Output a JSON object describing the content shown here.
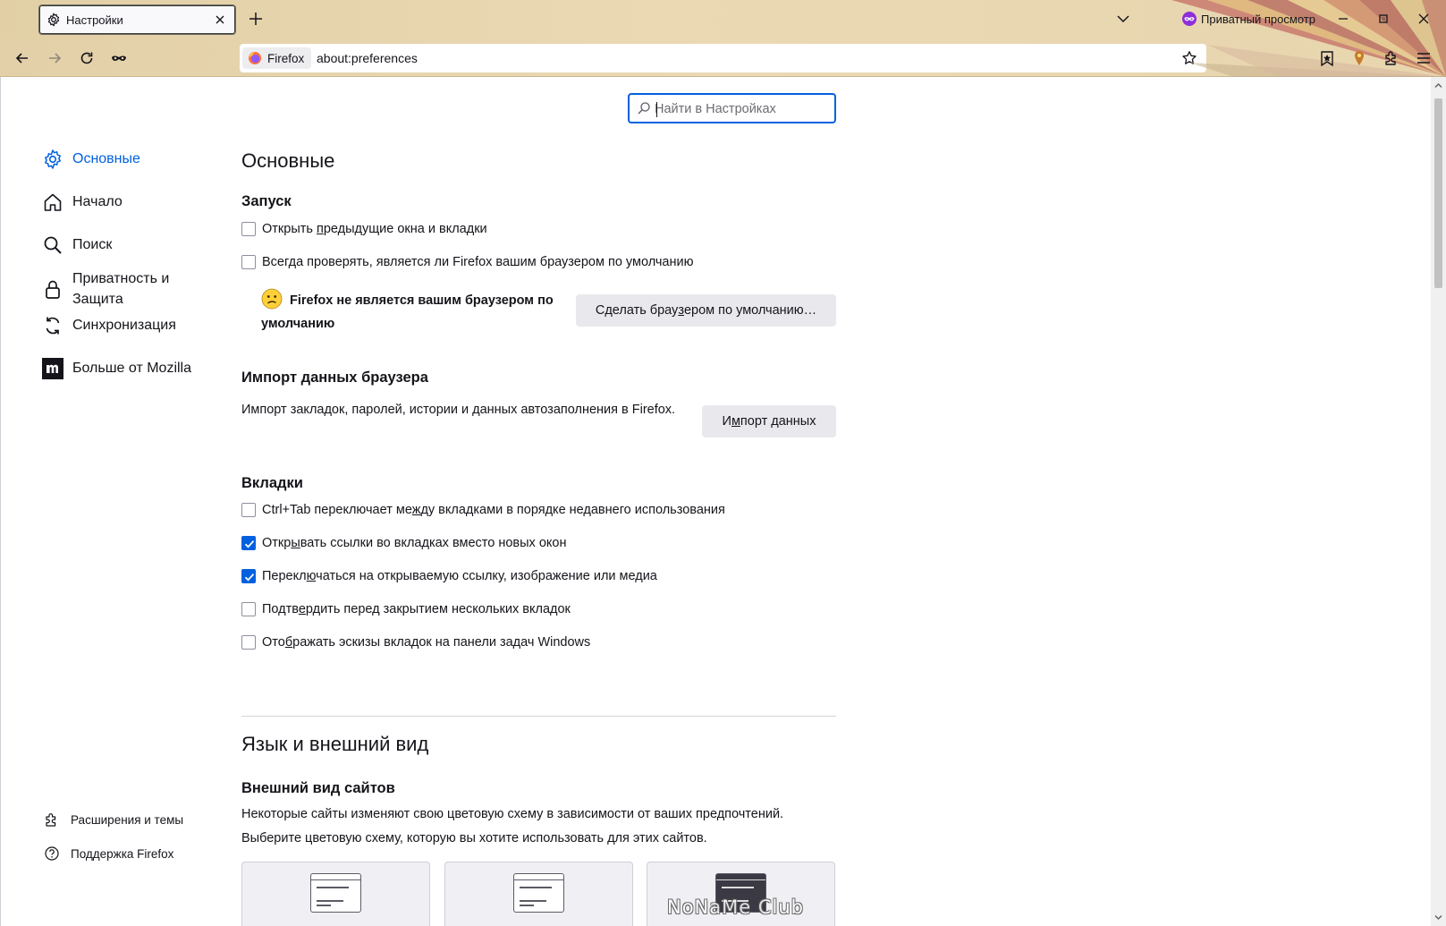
{
  "tab": {
    "title": "Настройки",
    "icon": "gear-icon"
  },
  "private_window": {
    "label": "Приватный просмотр"
  },
  "urlbar": {
    "identity_label": "Firefox",
    "url": "about:preferences"
  },
  "search": {
    "placeholder": "Найти в Настройках"
  },
  "sidebar": {
    "categories": [
      {
        "label": "Основные",
        "icon": "gear-icon",
        "selected": true
      },
      {
        "label": "Начало",
        "icon": "home-icon"
      },
      {
        "label": "Поиск",
        "icon": "search-icon"
      },
      {
        "label": "Приватность и Защита",
        "icon": "lock-icon"
      },
      {
        "label": "Синхронизация",
        "icon": "sync-icon"
      },
      {
        "label": "Больше от Mozilla",
        "icon": "mozilla-icon"
      }
    ],
    "footer": [
      {
        "label": "Расширения и темы",
        "icon": "puzzle-icon"
      },
      {
        "label": "Поддержка Firefox",
        "icon": "help-icon"
      }
    ]
  },
  "main": {
    "general_title": "Основные",
    "startup": {
      "heading": "Запуск",
      "restore_session": {
        "pre": "Открыть ",
        "key": "п",
        "post": "редыдущие окна и вкладки",
        "checked": false
      },
      "always_check": {
        "pre": "Всег",
        "key": "д",
        "post": "а проверять, является ли Firefox вашим браузером по умолчанию",
        "checked": false
      },
      "not_default_text": "Firefox не является вашим браузером по умолчанию",
      "make_default_button": {
        "pre": "Сделать брау",
        "key": "з",
        "post": "ером по умолчанию…"
      }
    },
    "import": {
      "heading": "Импорт данных браузера",
      "description": "Импорт закладок, паролей, истории и данных автозаполнения в Firefox.",
      "button": {
        "pre": "И",
        "key": "м",
        "post": "порт данных"
      }
    },
    "tabs": {
      "heading": "Вкладки",
      "items": [
        {
          "pre": "Ctrl+Tab переключает ме",
          "key": "ж",
          "post": "ду вкладками в порядке недавнего использования",
          "checked": false
        },
        {
          "pre": "Откр",
          "key": "ы",
          "post": "вать ссылки во вкладках вместо новых окон",
          "checked": true
        },
        {
          "pre": "Перекл",
          "key": "ю",
          "post": "чаться на открываемую ссылку, изображение или медиа",
          "checked": true
        },
        {
          "pre": "Подтв",
          "key": "е",
          "post": "рдить перед закрытием нескольких вкладок",
          "checked": false
        },
        {
          "pre": "Ото",
          "key": "б",
          "post": "ражать эскизы вкладок на панели задач Windows",
          "checked": false
        }
      ]
    },
    "language_title": "Язык и внешний вид",
    "appearance": {
      "heading": "Внешний вид сайтов",
      "desc1": "Некоторые сайты изменяют свою цветовую схему в зависимости от ваших предпочтений.",
      "desc2": "Выберите цветовую схему, которую вы хотите использовать для этих сайтов."
    }
  },
  "watermark": "NoNaMe Club",
  "colors": {
    "accent": "#0061e0",
    "frame": "#e9d6af",
    "button": "#e9e9ed"
  }
}
